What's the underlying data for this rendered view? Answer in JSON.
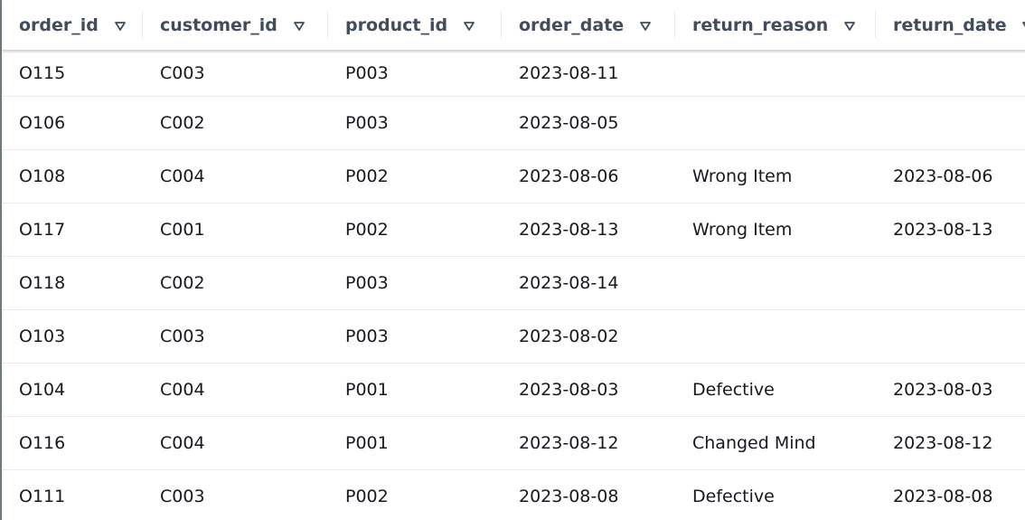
{
  "table": {
    "columns": [
      {
        "key": "order_id",
        "label": "order_id"
      },
      {
        "key": "customer_id",
        "label": "customer_id"
      },
      {
        "key": "product_id",
        "label": "product_id"
      },
      {
        "key": "order_date",
        "label": "order_date"
      },
      {
        "key": "return_reason",
        "label": "return_reason"
      },
      {
        "key": "return_date",
        "label": "return_date"
      }
    ],
    "rows": [
      [
        "O115",
        "C003",
        "P003",
        "2023-08-11",
        "",
        ""
      ],
      [
        "O106",
        "C002",
        "P003",
        "2023-08-05",
        "",
        ""
      ],
      [
        "O108",
        "C004",
        "P002",
        "2023-08-06",
        "Wrong Item",
        "2023-08-06"
      ],
      [
        "O117",
        "C001",
        "P002",
        "2023-08-13",
        "Wrong Item",
        "2023-08-13"
      ],
      [
        "O118",
        "C002",
        "P003",
        "2023-08-14",
        "",
        ""
      ],
      [
        "O103",
        "C003",
        "P003",
        "2023-08-02",
        "",
        ""
      ],
      [
        "O104",
        "C004",
        "P001",
        "2023-08-03",
        "Defective",
        "2023-08-03"
      ],
      [
        "O116",
        "C004",
        "P001",
        "2023-08-12",
        "Changed Mind",
        "2023-08-12"
      ],
      [
        "O111",
        "C003",
        "P002",
        "2023-08-08",
        "Defective",
        "2023-08-08"
      ]
    ]
  },
  "icons": {
    "sort": "sort-down-triangle-icon"
  },
  "colors": {
    "header_text": "#414d5c",
    "body_text": "#16191f",
    "row_divider": "#e9ebed"
  }
}
